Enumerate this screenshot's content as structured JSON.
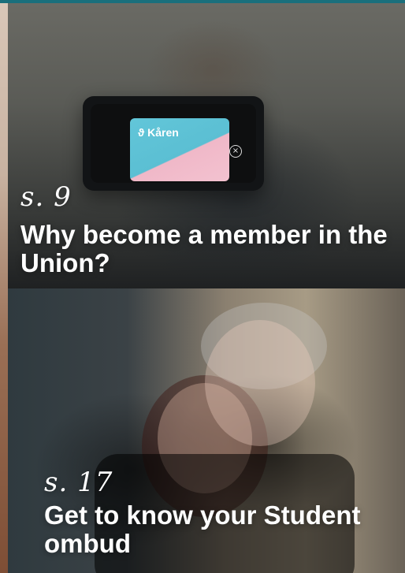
{
  "items": [
    {
      "page_ref": "s. 9",
      "title": "Why become a member in the Union?",
      "card_brand": "Kåren"
    },
    {
      "page_ref": "s. 17",
      "title": "Get to know your Student ombud"
    }
  ],
  "colors": {
    "top_bar": "#1a6f7c",
    "text": "#ffffff",
    "card_cyan": "#5bbfd3",
    "card_pink": "#f3c2d0"
  },
  "icons": {
    "close": "close-icon"
  }
}
